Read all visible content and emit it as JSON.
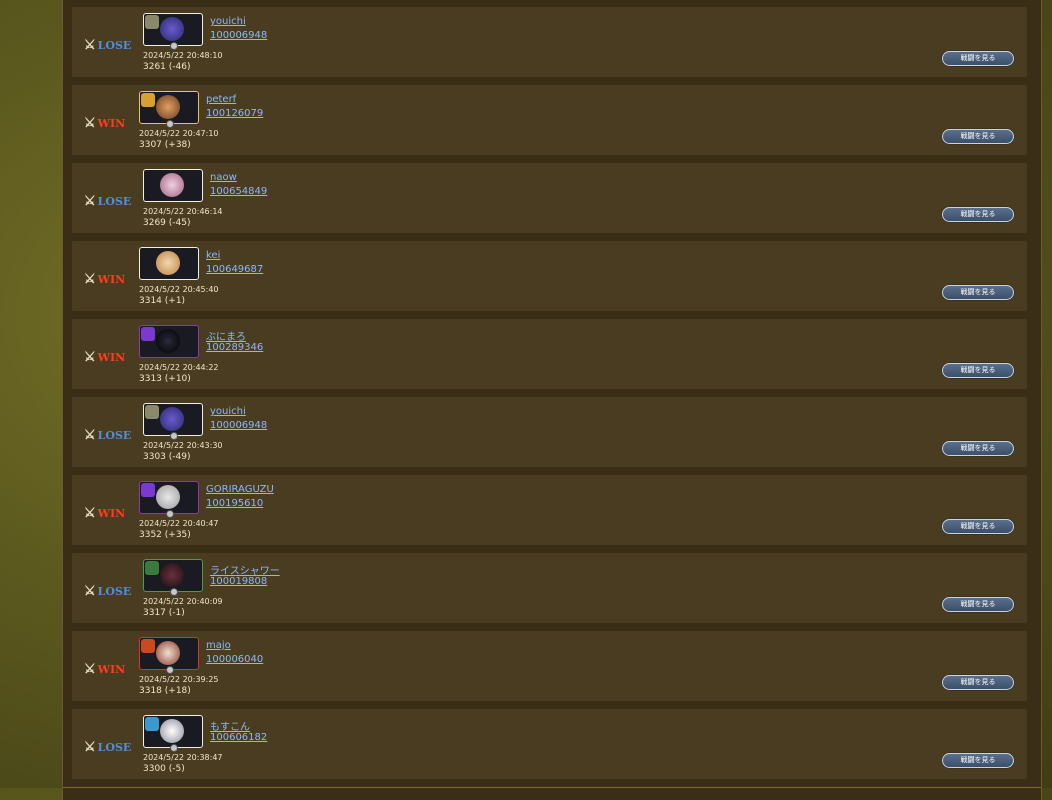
{
  "battles": [
    {
      "result": "LOSE",
      "name": "youichi",
      "id": "100006948",
      "datetime": "2024/5/22 20:48:10",
      "rating": "3261 (-46)",
      "frame": "white",
      "button": "戦闘を見る"
    },
    {
      "result": "WIN",
      "name": "peterf",
      "id": "100126079",
      "datetime": "2024/5/22 20:47:10",
      "rating": "3307 (+38)",
      "frame": "gold",
      "button": "戦闘を見る"
    },
    {
      "result": "LOSE",
      "name": "naow",
      "id": "100654849",
      "datetime": "2024/5/22 20:46:14",
      "rating": "3269 (-45)",
      "frame": "white",
      "button": "戦闘を見る"
    },
    {
      "result": "WIN",
      "name": "kei",
      "id": "100649687",
      "datetime": "2024/5/22 20:45:40",
      "rating": "3314 (+1)",
      "frame": "white",
      "button": "戦闘を見る"
    },
    {
      "result": "WIN",
      "name": "ぶにまろ",
      "id": "100289346",
      "datetime": "2024/5/22 20:44:22",
      "rating": "3313 (+10)",
      "frame": "purple",
      "button": "戦闘を見る"
    },
    {
      "result": "LOSE",
      "name": "youichi",
      "id": "100006948",
      "datetime": "2024/5/22 20:43:30",
      "rating": "3303 (-49)",
      "frame": "white",
      "button": "戦闘を見る"
    },
    {
      "result": "WIN",
      "name": "GORIRAGUZU",
      "id": "100195610",
      "datetime": "2024/5/22 20:40:47",
      "rating": "3352 (+35)",
      "frame": "purple",
      "button": "戦闘を見る"
    },
    {
      "result": "LOSE",
      "name": "ライスシャワー",
      "id": "100019808",
      "datetime": "2024/5/22 20:40:09",
      "rating": "3317 (-1)",
      "frame": "green",
      "button": "戦闘を見る"
    },
    {
      "result": "WIN",
      "name": "majo",
      "id": "100006040",
      "datetime": "2024/5/22 20:39:25",
      "rating": "3318 (+18)",
      "frame": "red",
      "button": "戦闘を見る"
    },
    {
      "result": "LOSE",
      "name": "もすこん",
      "id": "100606182",
      "datetime": "2024/5/22 20:38:47",
      "rating": "3300 (-5)",
      "frame": "white",
      "button": "戦闘を見る"
    }
  ],
  "colors": {
    "win": "#ff3b20",
    "lose": "#4f8fe0",
    "link": "#8ab8ff",
    "row_bg": "#4a3c20"
  }
}
